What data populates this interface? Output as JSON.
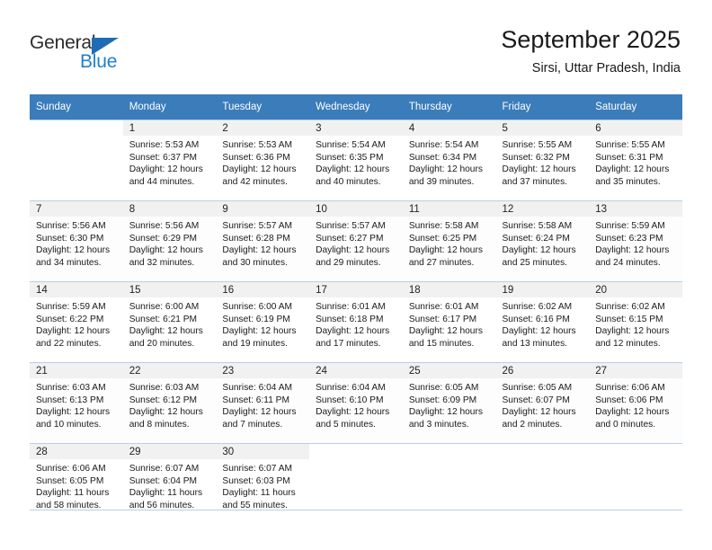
{
  "brand": {
    "name_top": "General",
    "name_bottom": "Blue",
    "triangle_icon": "triangle-icon",
    "colors": {
      "dark_text": "#2b2b2b",
      "blue_text": "#1f7fd4",
      "triangle": "#1f6cb4",
      "header_bar": "#3b7cba"
    }
  },
  "header": {
    "title": "September 2025",
    "subtitle": "Sirsi, Uttar Pradesh, India"
  },
  "calendar": {
    "weekday_headers": [
      "Sunday",
      "Monday",
      "Tuesday",
      "Wednesday",
      "Thursday",
      "Friday",
      "Saturday"
    ],
    "labels": {
      "sunrise": "Sunrise:",
      "sunset": "Sunset:",
      "daylight": "Daylight:"
    },
    "weeks": [
      [
        {
          "day": "",
          "lines": []
        },
        {
          "day": "1",
          "lines": [
            "Sunrise: 5:53 AM",
            "Sunset: 6:37 PM",
            "Daylight: 12 hours",
            "and 44 minutes."
          ]
        },
        {
          "day": "2",
          "lines": [
            "Sunrise: 5:53 AM",
            "Sunset: 6:36 PM",
            "Daylight: 12 hours",
            "and 42 minutes."
          ]
        },
        {
          "day": "3",
          "lines": [
            "Sunrise: 5:54 AM",
            "Sunset: 6:35 PM",
            "Daylight: 12 hours",
            "and 40 minutes."
          ]
        },
        {
          "day": "4",
          "lines": [
            "Sunrise: 5:54 AM",
            "Sunset: 6:34 PM",
            "Daylight: 12 hours",
            "and 39 minutes."
          ]
        },
        {
          "day": "5",
          "lines": [
            "Sunrise: 5:55 AM",
            "Sunset: 6:32 PM",
            "Daylight: 12 hours",
            "and 37 minutes."
          ]
        },
        {
          "day": "6",
          "lines": [
            "Sunrise: 5:55 AM",
            "Sunset: 6:31 PM",
            "Daylight: 12 hours",
            "and 35 minutes."
          ]
        }
      ],
      [
        {
          "day": "7",
          "lines": [
            "Sunrise: 5:56 AM",
            "Sunset: 6:30 PM",
            "Daylight: 12 hours",
            "and 34 minutes."
          ]
        },
        {
          "day": "8",
          "lines": [
            "Sunrise: 5:56 AM",
            "Sunset: 6:29 PM",
            "Daylight: 12 hours",
            "and 32 minutes."
          ]
        },
        {
          "day": "9",
          "lines": [
            "Sunrise: 5:57 AM",
            "Sunset: 6:28 PM",
            "Daylight: 12 hours",
            "and 30 minutes."
          ]
        },
        {
          "day": "10",
          "lines": [
            "Sunrise: 5:57 AM",
            "Sunset: 6:27 PM",
            "Daylight: 12 hours",
            "and 29 minutes."
          ]
        },
        {
          "day": "11",
          "lines": [
            "Sunrise: 5:58 AM",
            "Sunset: 6:25 PM",
            "Daylight: 12 hours",
            "and 27 minutes."
          ]
        },
        {
          "day": "12",
          "lines": [
            "Sunrise: 5:58 AM",
            "Sunset: 6:24 PM",
            "Daylight: 12 hours",
            "and 25 minutes."
          ]
        },
        {
          "day": "13",
          "lines": [
            "Sunrise: 5:59 AM",
            "Sunset: 6:23 PM",
            "Daylight: 12 hours",
            "and 24 minutes."
          ]
        }
      ],
      [
        {
          "day": "14",
          "lines": [
            "Sunrise: 5:59 AM",
            "Sunset: 6:22 PM",
            "Daylight: 12 hours",
            "and 22 minutes."
          ]
        },
        {
          "day": "15",
          "lines": [
            "Sunrise: 6:00 AM",
            "Sunset: 6:21 PM",
            "Daylight: 12 hours",
            "and 20 minutes."
          ]
        },
        {
          "day": "16",
          "lines": [
            "Sunrise: 6:00 AM",
            "Sunset: 6:19 PM",
            "Daylight: 12 hours",
            "and 19 minutes."
          ]
        },
        {
          "day": "17",
          "lines": [
            "Sunrise: 6:01 AM",
            "Sunset: 6:18 PM",
            "Daylight: 12 hours",
            "and 17 minutes."
          ]
        },
        {
          "day": "18",
          "lines": [
            "Sunrise: 6:01 AM",
            "Sunset: 6:17 PM",
            "Daylight: 12 hours",
            "and 15 minutes."
          ]
        },
        {
          "day": "19",
          "lines": [
            "Sunrise: 6:02 AM",
            "Sunset: 6:16 PM",
            "Daylight: 12 hours",
            "and 13 minutes."
          ]
        },
        {
          "day": "20",
          "lines": [
            "Sunrise: 6:02 AM",
            "Sunset: 6:15 PM",
            "Daylight: 12 hours",
            "and 12 minutes."
          ]
        }
      ],
      [
        {
          "day": "21",
          "lines": [
            "Sunrise: 6:03 AM",
            "Sunset: 6:13 PM",
            "Daylight: 12 hours",
            "and 10 minutes."
          ]
        },
        {
          "day": "22",
          "lines": [
            "Sunrise: 6:03 AM",
            "Sunset: 6:12 PM",
            "Daylight: 12 hours",
            "and 8 minutes."
          ]
        },
        {
          "day": "23",
          "lines": [
            "Sunrise: 6:04 AM",
            "Sunset: 6:11 PM",
            "Daylight: 12 hours",
            "and 7 minutes."
          ]
        },
        {
          "day": "24",
          "lines": [
            "Sunrise: 6:04 AM",
            "Sunset: 6:10 PM",
            "Daylight: 12 hours",
            "and 5 minutes."
          ]
        },
        {
          "day": "25",
          "lines": [
            "Sunrise: 6:05 AM",
            "Sunset: 6:09 PM",
            "Daylight: 12 hours",
            "and 3 minutes."
          ]
        },
        {
          "day": "26",
          "lines": [
            "Sunrise: 6:05 AM",
            "Sunset: 6:07 PM",
            "Daylight: 12 hours",
            "and 2 minutes."
          ]
        },
        {
          "day": "27",
          "lines": [
            "Sunrise: 6:06 AM",
            "Sunset: 6:06 PM",
            "Daylight: 12 hours",
            "and 0 minutes."
          ]
        }
      ],
      [
        {
          "day": "28",
          "lines": [
            "Sunrise: 6:06 AM",
            "Sunset: 6:05 PM",
            "Daylight: 11 hours",
            "and 58 minutes."
          ]
        },
        {
          "day": "29",
          "lines": [
            "Sunrise: 6:07 AM",
            "Sunset: 6:04 PM",
            "Daylight: 11 hours",
            "and 56 minutes."
          ]
        },
        {
          "day": "30",
          "lines": [
            "Sunrise: 6:07 AM",
            "Sunset: 6:03 PM",
            "Daylight: 11 hours",
            "and 55 minutes."
          ]
        },
        {
          "day": "",
          "lines": []
        },
        {
          "day": "",
          "lines": []
        },
        {
          "day": "",
          "lines": []
        },
        {
          "day": "",
          "lines": []
        }
      ]
    ]
  }
}
